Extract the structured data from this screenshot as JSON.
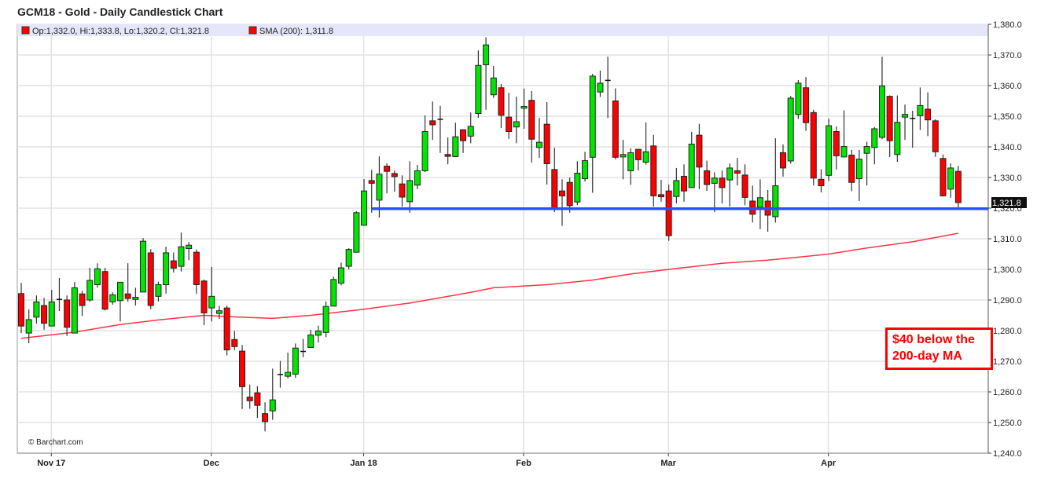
{
  "title": "GCM18 - Gold - Daily Candlestick Chart",
  "legend": {
    "ohlc": "Op:1,332.0, Hi:1,333.8, Lo:1,320.2, Cl:1,321.8",
    "sma": "SMA (200): 1,311.8"
  },
  "watermark": "© Barchart.com",
  "annotation": {
    "line1": "$40 below the",
    "line2": "200-day MA"
  },
  "last_price_label": "1,321.8",
  "colors": {
    "up": "#00e600",
    "down": "#ff0000",
    "sma": "#ff3344",
    "support": "#2a4fff",
    "legend_bg": "#e6e6fa"
  },
  "chart_data": {
    "type": "candlestick",
    "title": "GCM18 - Gold - Daily Candlestick Chart",
    "ylim": [
      1240,
      1380
    ],
    "yticks": [
      "1,240.0",
      "1,250.0",
      "1,260.0",
      "1,270.0",
      "1,280.0",
      "1,290.0",
      "1,300.0",
      "1,310.0",
      "1,320.0",
      "1,330.0",
      "1,340.0",
      "1,350.0",
      "1,360.0",
      "1,370.0",
      "1,380.0"
    ],
    "ytick_values": [
      1240,
      1250,
      1260,
      1270,
      1280,
      1290,
      1300,
      1310,
      1320,
      1330,
      1340,
      1350,
      1360,
      1370,
      1380
    ],
    "xticks": [
      {
        "label": "Nov 17",
        "index": 4
      },
      {
        "label": "Dec",
        "index": 25
      },
      {
        "label": "Jan 18",
        "index": 45
      },
      {
        "label": "Feb",
        "index": 66
      },
      {
        "label": "Mar",
        "index": 85
      },
      {
        "label": "Apr",
        "index": 106
      }
    ],
    "grid": true,
    "ohlc_fields": [
      "open",
      "high",
      "low",
      "close"
    ],
    "candles": [
      [
        1292.1,
        1295.6,
        1279.2,
        1281.5
      ],
      [
        1279.2,
        1286.9,
        1275.9,
        1283.6
      ],
      [
        1284.4,
        1291.5,
        1282.3,
        1289.4
      ],
      [
        1288.2,
        1290.7,
        1280.3,
        1282.4
      ],
      [
        1281.5,
        1293.3,
        1281.5,
        1289.4
      ],
      [
        1290.2,
        1297.2,
        1286.4,
        1290.2
      ],
      [
        1290.0,
        1291.5,
        1278.3,
        1281.1
      ],
      [
        1279.2,
        1295.9,
        1279.2,
        1294.0
      ],
      [
        1292.0,
        1293.0,
        1284.8,
        1288.2
      ],
      [
        1290.0,
        1300.5,
        1289.4,
        1296.4
      ],
      [
        1295.0,
        1302.0,
        1294.0,
        1300.2
      ],
      [
        1299.3,
        1300.5,
        1286.6,
        1287.0
      ],
      [
        1289.4,
        1292.5,
        1288.5,
        1291.7
      ],
      [
        1289.8,
        1295.8,
        1283.0,
        1295.8
      ],
      [
        1292.0,
        1302.0,
        1289.5,
        1290.5
      ],
      [
        1290.2,
        1294.0,
        1288.2,
        1290.9
      ],
      [
        1292.6,
        1310.2,
        1292.6,
        1309.2
      ],
      [
        1305.4,
        1306.6,
        1287.0,
        1288.2
      ],
      [
        1291.2,
        1296.0,
        1289.5,
        1295.0
      ],
      [
        1295.0,
        1307.4,
        1292.1,
        1305.4
      ],
      [
        1302.8,
        1305.5,
        1299.0,
        1300.4
      ],
      [
        1301.0,
        1312.0,
        1299.3,
        1307.4
      ],
      [
        1306.8,
        1308.9,
        1303.0,
        1307.9
      ],
      [
        1305.6,
        1306.5,
        1292.0,
        1295.0
      ],
      [
        1296.2,
        1296.7,
        1281.8,
        1285.8
      ],
      [
        1287.4,
        1300.8,
        1283.0,
        1291.2
      ],
      [
        1285.6,
        1288.1,
        1283.8,
        1286.5
      ],
      [
        1287.4,
        1288.2,
        1271.9,
        1273.7
      ],
      [
        1277.1,
        1279.9,
        1273.6,
        1274.8
      ],
      [
        1273.3,
        1275.3,
        1254.4,
        1261.7
      ],
      [
        1258.3,
        1262.4,
        1254.5,
        1257.1
      ],
      [
        1259.7,
        1261.9,
        1251.5,
        1255.6
      ],
      [
        1252.9,
        1256.6,
        1247.1,
        1250.3
      ],
      [
        1253.8,
        1267.6,
        1250.9,
        1257.4
      ],
      [
        1265.7,
        1270.1,
        1261.4,
        1265.7
      ],
      [
        1265.1,
        1272.8,
        1264.4,
        1266.4
      ],
      [
        1265.8,
        1275.8,
        1264.6,
        1274.3
      ],
      [
        1273.2,
        1277.3,
        1271.3,
        1273.2
      ],
      [
        1274.5,
        1280.3,
        1274.5,
        1278.6
      ],
      [
        1278.5,
        1281.6,
        1276.1,
        1279.9
      ],
      [
        1279.4,
        1289.5,
        1277.9,
        1287.9
      ],
      [
        1288.0,
        1297.6,
        1288.0,
        1296.7
      ],
      [
        1295.5,
        1302.2,
        1294.8,
        1300.5
      ],
      [
        1301.0,
        1306.9,
        1300.0,
        1306.5
      ],
      [
        1305.6,
        1319.0,
        1305.6,
        1318.5
      ],
      [
        1314.4,
        1329.5,
        1314.4,
        1325.6
      ],
      [
        1329.0,
        1332.5,
        1318.5,
        1328.1
      ],
      [
        1322.6,
        1336.9,
        1316.9,
        1331.1
      ],
      [
        1333.7,
        1334.6,
        1324.8,
        1332.0
      ],
      [
        1331.3,
        1332.3,
        1325.4,
        1330.3
      ],
      [
        1327.9,
        1330.7,
        1320.5,
        1323.6
      ],
      [
        1322.1,
        1335.3,
        1318.5,
        1329.0
      ],
      [
        1327.5,
        1334.1,
        1326.2,
        1332.2
      ],
      [
        1332.2,
        1350.3,
        1331.8,
        1345.0
      ],
      [
        1348.5,
        1354.8,
        1342.3,
        1347.2
      ],
      [
        1349.0,
        1353.4,
        1338.0,
        1349.0
      ],
      [
        1337.5,
        1343.1,
        1334.3,
        1336.9
      ],
      [
        1336.8,
        1347.9,
        1336.8,
        1343.3
      ],
      [
        1345.6,
        1345.6,
        1338.0,
        1342.0
      ],
      [
        1343.5,
        1351.2,
        1341.2,
        1346.7
      ],
      [
        1350.9,
        1371.5,
        1349.5,
        1366.6
      ],
      [
        1366.8,
        1375.8,
        1352.1,
        1373.3
      ],
      [
        1357.0,
        1366.4,
        1356.0,
        1362.5
      ],
      [
        1359.3,
        1360.6,
        1346.1,
        1350.3
      ],
      [
        1349.7,
        1357.6,
        1342.6,
        1345.0
      ],
      [
        1346.5,
        1356.4,
        1341.2,
        1348.2
      ],
      [
        1352.6,
        1359.0,
        1345.9,
        1353.2
      ],
      [
        1355.2,
        1358.2,
        1334.9,
        1342.5
      ],
      [
        1339.8,
        1349.5,
        1336.4,
        1341.5
      ],
      [
        1347.4,
        1354.6,
        1327.7,
        1334.5
      ],
      [
        1332.6,
        1339.7,
        1318.7,
        1319.6
      ],
      [
        1325.6,
        1329.4,
        1314.2,
        1324.0
      ],
      [
        1328.4,
        1330.0,
        1318.5,
        1320.8
      ],
      [
        1322.0,
        1335.3,
        1321.0,
        1331.4
      ],
      [
        1329.6,
        1338.4,
        1328.7,
        1335.5
      ],
      [
        1336.6,
        1363.8,
        1325.0,
        1363.1
      ],
      [
        1357.9,
        1364.9,
        1356.3,
        1360.8
      ],
      [
        1361.7,
        1369.4,
        1349.4,
        1361.7
      ],
      [
        1355.0,
        1359.1,
        1335.9,
        1336.6
      ],
      [
        1336.7,
        1342.3,
        1329.4,
        1337.5
      ],
      [
        1332.2,
        1339.5,
        1327.6,
        1338.1
      ],
      [
        1339.2,
        1339.2,
        1332.3,
        1335.8
      ],
      [
        1335.0,
        1348.0,
        1334.2,
        1338.4
      ],
      [
        1340.3,
        1343.9,
        1320.5,
        1324.0
      ],
      [
        1324.4,
        1329.2,
        1322.1,
        1323.7
      ],
      [
        1325.6,
        1327.7,
        1309.3,
        1311.0
      ],
      [
        1323.8,
        1333.1,
        1321.5,
        1329.0
      ],
      [
        1330.4,
        1334.3,
        1322.1,
        1325.6
      ],
      [
        1326.7,
        1344.9,
        1326.7,
        1340.9
      ],
      [
        1343.8,
        1347.5,
        1326.2,
        1333.4
      ],
      [
        1332.2,
        1335.5,
        1325.6,
        1327.7
      ],
      [
        1328.1,
        1331.7,
        1318.7,
        1329.8
      ],
      [
        1329.8,
        1332.3,
        1321.5,
        1326.7
      ],
      [
        1329.2,
        1334.6,
        1320.5,
        1333.1
      ],
      [
        1332.2,
        1336.4,
        1327.4,
        1331.4
      ],
      [
        1330.8,
        1334.3,
        1320.9,
        1323.5
      ],
      [
        1322.3,
        1327.4,
        1315.3,
        1318.0
      ],
      [
        1320.3,
        1329.4,
        1313.1,
        1323.4
      ],
      [
        1322.3,
        1325.9,
        1312.3,
        1317.7
      ],
      [
        1317.2,
        1342.8,
        1315.3,
        1327.3
      ],
      [
        1338.1,
        1340.8,
        1330.3,
        1333.1
      ],
      [
        1335.4,
        1356.6,
        1334.5,
        1355.9
      ],
      [
        1350.6,
        1361.8,
        1349.1,
        1360.8
      ],
      [
        1359.3,
        1362.8,
        1345.2,
        1347.9
      ],
      [
        1351.2,
        1352.1,
        1327.4,
        1329.8
      ],
      [
        1329.4,
        1332.7,
        1325.1,
        1327.3
      ],
      [
        1330.7,
        1349.2,
        1328.9,
        1346.9
      ],
      [
        1345.0,
        1346.7,
        1332.6,
        1337.1
      ],
      [
        1336.7,
        1351.9,
        1336.7,
        1340.1
      ],
      [
        1337.3,
        1339.0,
        1325.5,
        1328.4
      ],
      [
        1329.6,
        1339.0,
        1322.3,
        1336.0
      ],
      [
        1337.9,
        1341.7,
        1327.4,
        1340.1
      ],
      [
        1339.8,
        1346.5,
        1334.3,
        1345.9
      ],
      [
        1343.1,
        1369.4,
        1342.5,
        1359.9
      ],
      [
        1356.5,
        1356.8,
        1336.7,
        1342.0
      ],
      [
        1337.5,
        1356.8,
        1335.1,
        1348.0
      ],
      [
        1349.7,
        1353.8,
        1342.3,
        1350.6
      ],
      [
        1349.3,
        1351.8,
        1339.7,
        1349.3
      ],
      [
        1350.2,
        1359.4,
        1345.5,
        1353.5
      ],
      [
        1352.3,
        1357.8,
        1343.5,
        1348.8
      ],
      [
        1348.5,
        1349.0,
        1336.7,
        1338.4
      ],
      [
        1336.2,
        1337.5,
        1323.8,
        1324.0
      ],
      [
        1326.2,
        1334.6,
        1323.4,
        1333.1
      ],
      [
        1332.0,
        1333.8,
        1320.2,
        1321.8
      ]
    ],
    "sma200": [
      [
        0,
        1277.5
      ],
      [
        7,
        1279.5
      ],
      [
        13,
        1282
      ],
      [
        18,
        1283.5
      ],
      [
        24,
        1285
      ],
      [
        28,
        1284.5
      ],
      [
        33,
        1284
      ],
      [
        38,
        1285
      ],
      [
        45,
        1287
      ],
      [
        51,
        1289
      ],
      [
        59,
        1292.5
      ],
      [
        62,
        1294
      ],
      [
        69,
        1295
      ],
      [
        75,
        1296.5
      ],
      [
        80,
        1298.5
      ],
      [
        85,
        1300
      ],
      [
        92,
        1302
      ],
      [
        98,
        1303
      ],
      [
        106,
        1305
      ],
      [
        111,
        1307
      ],
      [
        117,
        1309
      ],
      [
        123,
        1311.8
      ]
    ],
    "support_line": {
      "value": 1319.8,
      "start_index": 46
    }
  }
}
